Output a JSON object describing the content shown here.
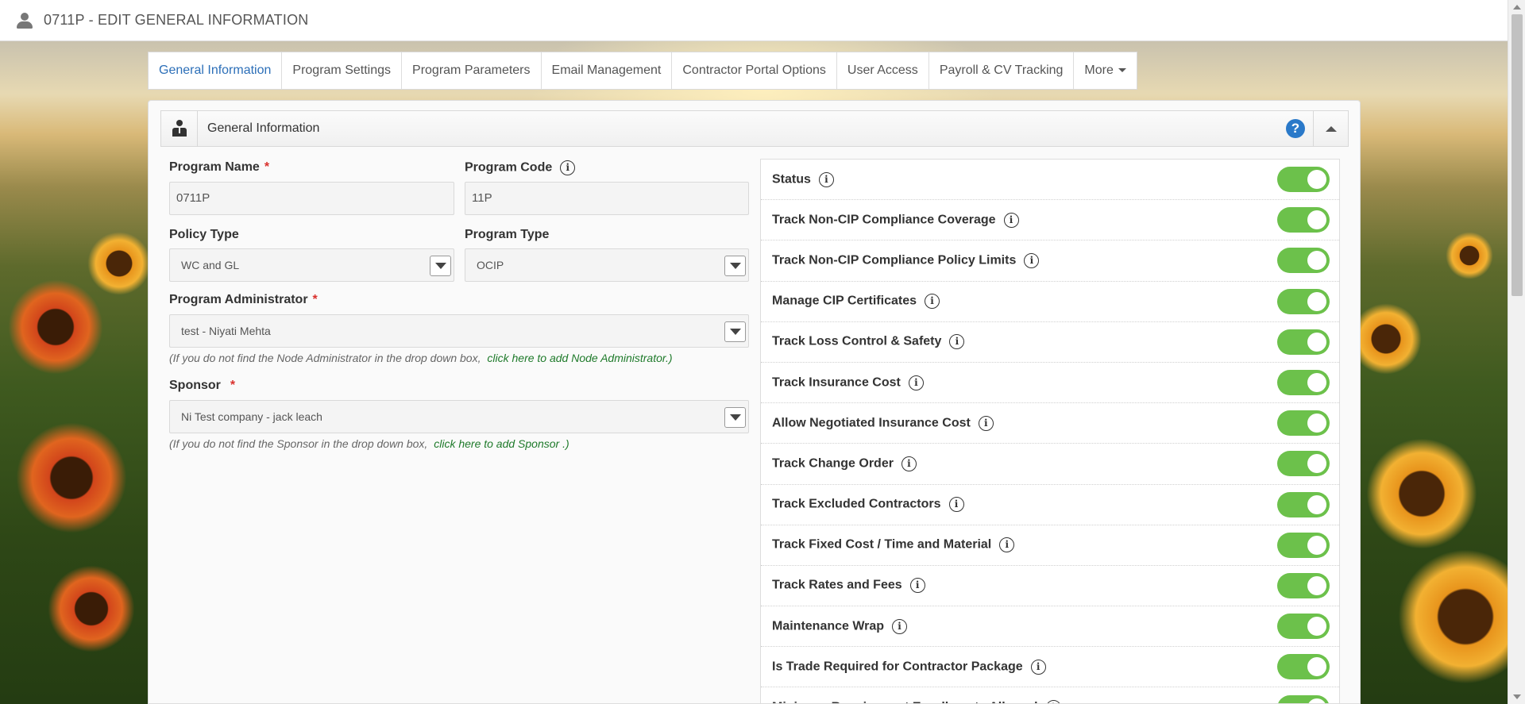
{
  "page": {
    "title": "0711P - EDIT GENERAL INFORMATION"
  },
  "tabs": [
    {
      "label": "General Information",
      "active": true
    },
    {
      "label": "Program Settings"
    },
    {
      "label": "Program Parameters"
    },
    {
      "label": "Email Management"
    },
    {
      "label": "Contractor Portal Options"
    },
    {
      "label": "User Access"
    },
    {
      "label": "Payroll & CV Tracking"
    },
    {
      "label": "More"
    }
  ],
  "panel": {
    "title": "General Information",
    "help_icon": "?"
  },
  "form": {
    "program_name": {
      "label": "Program Name",
      "required": "*",
      "value": "0711P"
    },
    "program_code": {
      "label": "Program Code",
      "value": "11P"
    },
    "policy_type": {
      "label": "Policy Type",
      "value": "WC and GL"
    },
    "program_type": {
      "label": "Program Type",
      "value": "OCIP"
    },
    "program_admin": {
      "label": "Program Administrator",
      "required": "*",
      "value": "test - Niyati Mehta",
      "hint": "(If you do not find the Node Administrator in the drop down box,",
      "hint_link": "click here to add Node Administrator.)"
    },
    "sponsor": {
      "label": "Sponsor",
      "required": "*",
      "value": "Ni Test company - jack leach",
      "hint": "(If you do not find the Sponsor in the drop down box,",
      "hint_link": "click here to add Sponsor .)"
    }
  },
  "info_glyph": "i",
  "toggles": [
    {
      "label": "Status",
      "on": true
    },
    {
      "label": "Track Non-CIP Compliance Coverage",
      "on": true
    },
    {
      "label": "Track Non-CIP Compliance Policy Limits",
      "on": true
    },
    {
      "label": "Manage CIP Certificates",
      "on": true
    },
    {
      "label": "Track Loss Control & Safety",
      "on": true
    },
    {
      "label": "Track Insurance Cost",
      "on": true
    },
    {
      "label": "Allow Negotiated Insurance Cost",
      "on": true
    },
    {
      "label": "Track Change Order",
      "on": true
    },
    {
      "label": "Track Excluded Contractors",
      "on": true
    },
    {
      "label": "Track Fixed Cost / Time and Material",
      "on": true
    },
    {
      "label": "Track Rates and Fees",
      "on": true
    },
    {
      "label": "Maintenance Wrap",
      "on": true
    },
    {
      "label": "Is Trade Required for Contractor Package",
      "on": true
    },
    {
      "label": "Minimum Requirement Enrollments Allowed",
      "on": true
    }
  ],
  "colors": {
    "accent": "#2c6fb8",
    "toggle_on": "#6cc14b",
    "required": "#d9302c",
    "link": "#1e7a2a",
    "help": "#2a79c9"
  }
}
